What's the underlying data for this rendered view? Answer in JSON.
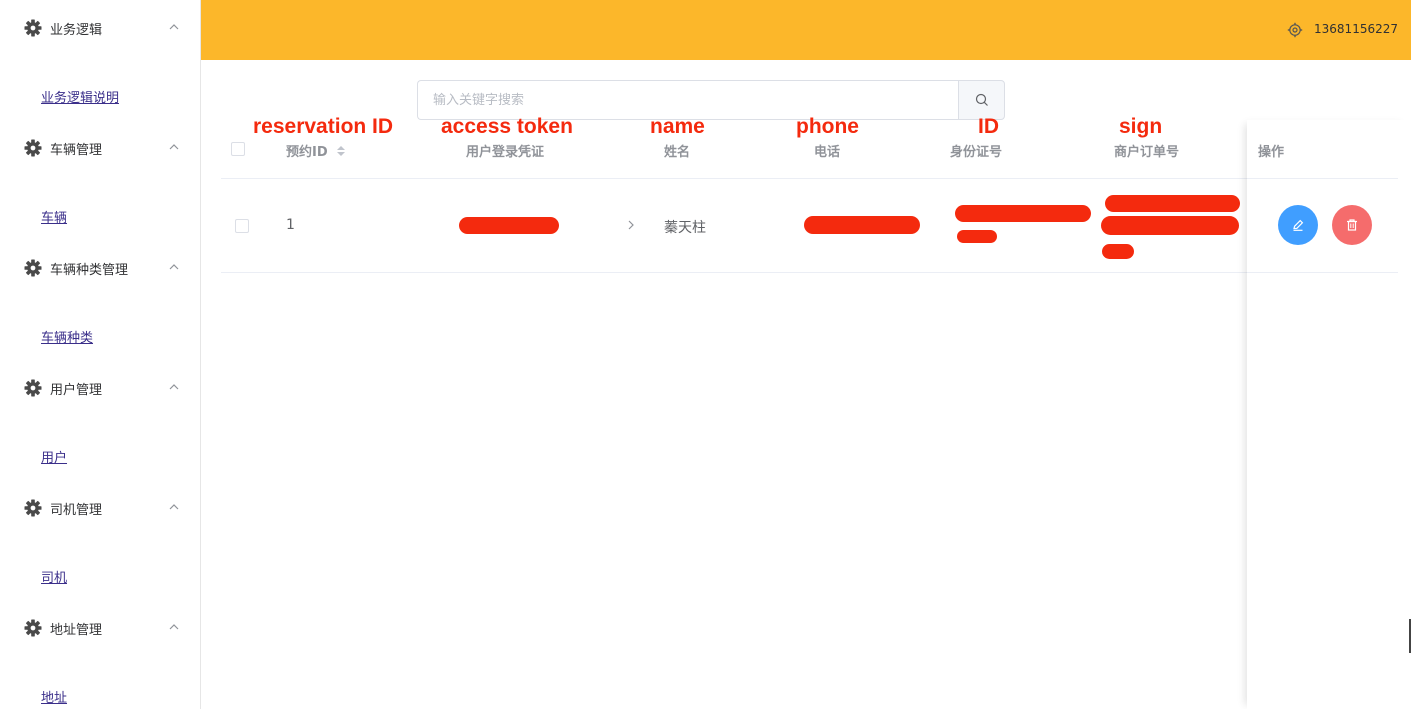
{
  "sidebar": {
    "groups": [
      {
        "title": "业务逻辑",
        "link": "业务逻辑说明"
      },
      {
        "title": "车辆管理",
        "link": "车辆"
      },
      {
        "title": "车辆种类管理",
        "link": "车辆种类"
      },
      {
        "title": "用户管理",
        "link": "用户"
      },
      {
        "title": "司机管理",
        "link": "司机"
      },
      {
        "title": "地址管理",
        "link": "地址"
      }
    ]
  },
  "header": {
    "user": "13681156227",
    "bg_color": "#fcb72a"
  },
  "search": {
    "placeholder": "输入关键字搜索"
  },
  "annotations": {
    "reservation_id": "reservation ID",
    "access_token": "access token",
    "name": "name",
    "phone": "phone",
    "id": "ID",
    "sign": "sign",
    "color": "#f42a0e"
  },
  "table": {
    "columns": {
      "reservation_id": "预约ID",
      "token": "用户登录凭证",
      "name": "姓名",
      "phone": "电话",
      "id_card": "身份证号",
      "order_no": "商户订单号",
      "ops": "操作"
    },
    "rows": [
      {
        "reservation_id": "1",
        "name": "蓁天柱"
      }
    ]
  },
  "colors": {
    "edit_button": "#409eff",
    "delete_button": "#f56c6c"
  }
}
